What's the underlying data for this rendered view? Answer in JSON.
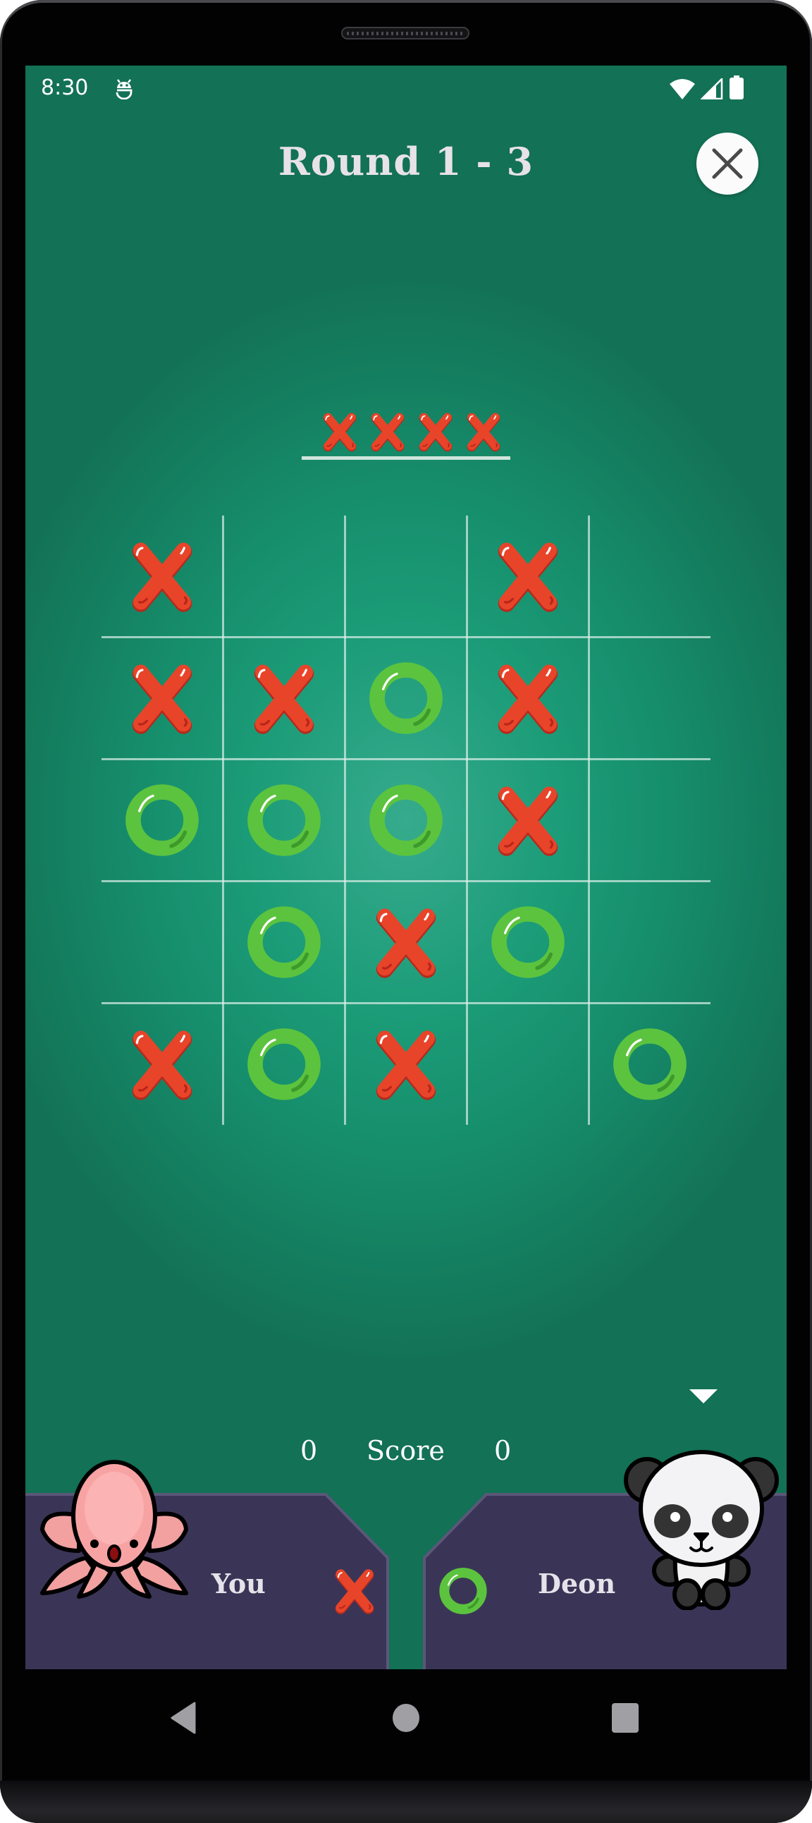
{
  "status_bar": {
    "time": "8:30",
    "icons": [
      "android-debug-icon",
      "wifi-icon",
      "signal-icon",
      "battery-icon"
    ]
  },
  "header": {
    "title": "Round 1 - 3",
    "close_icon": "close-icon"
  },
  "goal": {
    "description": "Get 4 in a row",
    "symbol": "X",
    "count": 4
  },
  "board": {
    "size": 5,
    "cells": [
      [
        "X",
        "",
        "",
        "X",
        ""
      ],
      [
        "X",
        "X",
        "O",
        "X",
        ""
      ],
      [
        "O",
        "O",
        "O",
        "X",
        ""
      ],
      [
        "",
        "O",
        "X",
        "O",
        ""
      ],
      [
        "X",
        "O",
        "X",
        "",
        "O"
      ]
    ]
  },
  "score": {
    "label": "Score",
    "player1": "0",
    "player2": "0"
  },
  "players": [
    {
      "name": "You",
      "mark": "X",
      "avatar": "octopus-avatar"
    },
    {
      "name": "Deon",
      "mark": "O",
      "avatar": "panda-avatar"
    }
  ],
  "colors": {
    "x_mark": "#e8442a",
    "o_mark": "#5cc33f",
    "panel": "#3a3556",
    "panel_border": "#5b5779",
    "background": "#137155"
  },
  "nav_bar": {
    "back": "back-icon",
    "home": "home-icon",
    "recents": "recents-icon"
  }
}
